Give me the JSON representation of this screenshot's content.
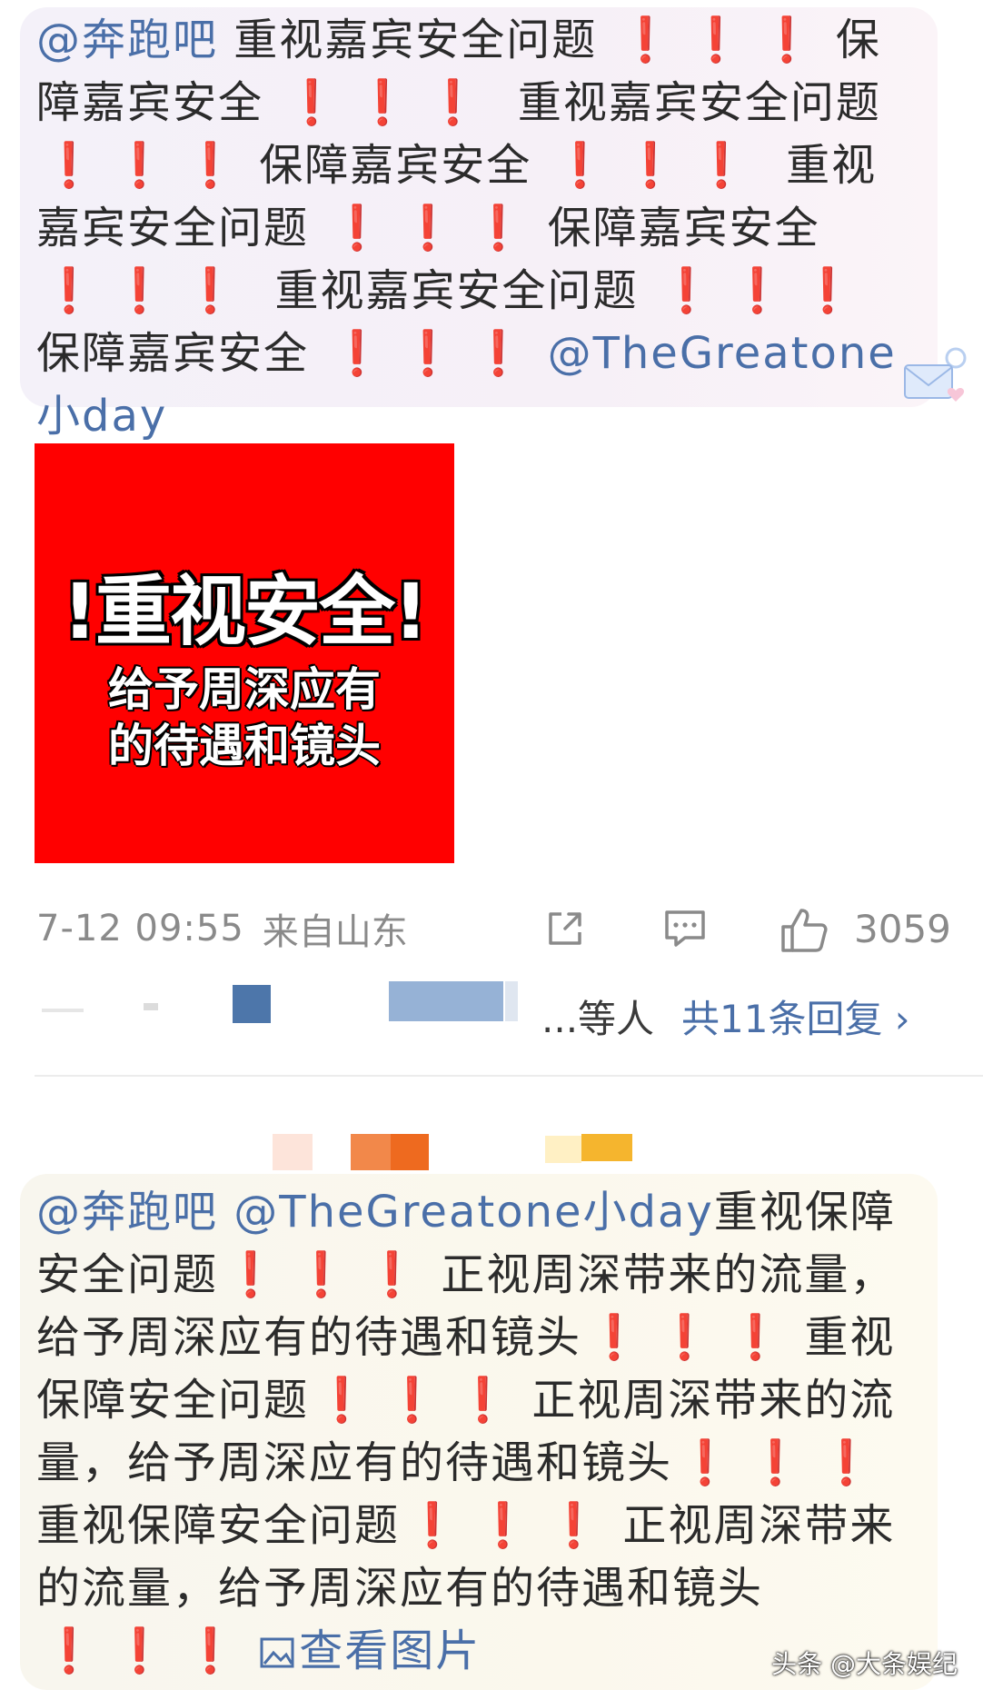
{
  "comment1": {
    "mention_start": "@奔跑吧",
    "segments": [
      {
        "text": " 重视嘉宾安全问题 "
      },
      {
        "bang": "❗❗❗"
      },
      {
        "text": "保障嘉宾安全 "
      },
      {
        "bang": "❗❗❗"
      },
      {
        "text": " 重视嘉宾安全问题 "
      },
      {
        "bang": "❗❗❗"
      },
      {
        "text": "保障嘉宾安全 "
      },
      {
        "bang": "❗❗❗"
      },
      {
        "text": " 重视嘉宾安全问题 "
      },
      {
        "bang": "❗❗❗"
      },
      {
        "text": "保障嘉宾安全 "
      },
      {
        "bang": "❗❗❗"
      },
      {
        "text": " 重视嘉宾安全问题 "
      },
      {
        "bang": "❗❗❗"
      },
      {
        "text": "保障嘉宾安全 "
      },
      {
        "bang": "❗❗❗"
      }
    ],
    "mention_end": "@TheGreatone小day"
  },
  "image_card": {
    "title": "!重视安全!",
    "subtitle_line1": "给予周深应有",
    "subtitle_line2": "的待遇和镜头"
  },
  "meta": {
    "time": "7-12 09:55",
    "location": "来自山东",
    "share_icon": "share-icon",
    "comment_icon": "comment-icon",
    "like_icon": "thumbs-up-icon",
    "like_count": "3059"
  },
  "replies": {
    "etc_label": "...等人",
    "total_label": "共11条回复 ›"
  },
  "comment2": {
    "mention1": "@奔跑吧",
    "mention2": "@TheGreatone小day",
    "segments": [
      {
        "text": "重视保障安全问题"
      },
      {
        "bang": "❗❗❗"
      },
      {
        "text": "正视周深带来的流量，给予周深应有的待遇和镜头"
      },
      {
        "bang": "❗❗❗"
      },
      {
        "text": "重视保障安全问题"
      },
      {
        "bang": "❗❗❗"
      },
      {
        "text": "正视周深带来的流量，给予周深应有的待遇和镜头"
      },
      {
        "bang": "❗❗❗"
      },
      {
        "text": "重视保障安全问题"
      },
      {
        "bang": "❗❗❗"
      },
      {
        "text": "正视周深带来的流量，给予周深应有的待遇和镜头"
      },
      {
        "bang": "❗❗❗"
      }
    ],
    "view_image_label": "查看图片",
    "view_image_icon": "image-icon"
  },
  "watermark": "头条 @大条娱纪",
  "colors": {
    "mention": "#4a6fa8",
    "bang": "#e02020",
    "card_bg": "#ff0000",
    "meta_gray": "#8a8a8a"
  }
}
